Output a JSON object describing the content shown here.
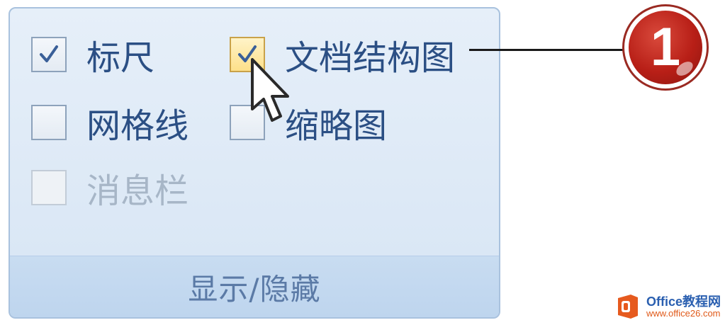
{
  "group": {
    "title": "显示/隐藏",
    "options": [
      {
        "id": "ruler",
        "label": "标尺",
        "checked": true,
        "disabled": false
      },
      {
        "id": "doc-map",
        "label": "文档结构图",
        "checked": true,
        "disabled": false,
        "hover": true
      },
      {
        "id": "gridlines",
        "label": "网格线",
        "checked": false,
        "disabled": false
      },
      {
        "id": "thumbnails",
        "label": "缩略图",
        "checked": false,
        "disabled": false
      },
      {
        "id": "message-bar",
        "label": "消息栏",
        "checked": false,
        "disabled": true
      }
    ]
  },
  "callout": {
    "number": "1"
  },
  "watermark": {
    "line1": "Office教程网",
    "line2": "www.office26.com"
  },
  "colors": {
    "label": "#2b4f84",
    "disabled_label": "#a7b6c7",
    "check": "#3a5f98",
    "callout_red": "#b81f17",
    "watermark_orange": "#e65a1e"
  }
}
